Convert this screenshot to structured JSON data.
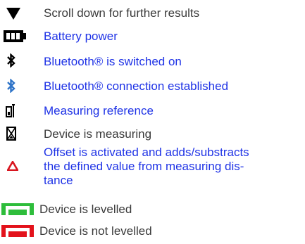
{
  "legend": {
    "items": [
      {
        "icon": "triangle-down-icon",
        "text": "Scroll down for further results",
        "link": false
      },
      {
        "icon": "battery-icon",
        "text": "Battery power",
        "link": true
      },
      {
        "icon": "bluetooth-icon",
        "text": "Bluetooth® is switched on",
        "link": true
      },
      {
        "icon": "bluetooth-connected-icon",
        "text": "Bluetooth® connection established",
        "link": true
      },
      {
        "icon": "measuring-reference-icon",
        "text": "Measuring reference",
        "link": true
      },
      {
        "icon": "hourglass-icon",
        "text": "Device is measuring",
        "link": false
      },
      {
        "icon": "offset-triangle-icon",
        "lines": [
          "Offset is activated and adds/substracts",
          "the defined value from measuring dis-",
          "tance"
        ],
        "link": true
      },
      {
        "icon": "level-green-icon",
        "text": "Device is levelled",
        "link": false
      },
      {
        "icon": "level-red-icon",
        "text": "Device is not levelled",
        "link": false
      }
    ]
  },
  "colors": {
    "link": "#1f33e6",
    "text": "#3a3a3a",
    "level_ok": "#2ebd3b",
    "level_bad": "#e3121b",
    "offset": "#d81620",
    "bluetooth_connected": "#2f74c8"
  }
}
